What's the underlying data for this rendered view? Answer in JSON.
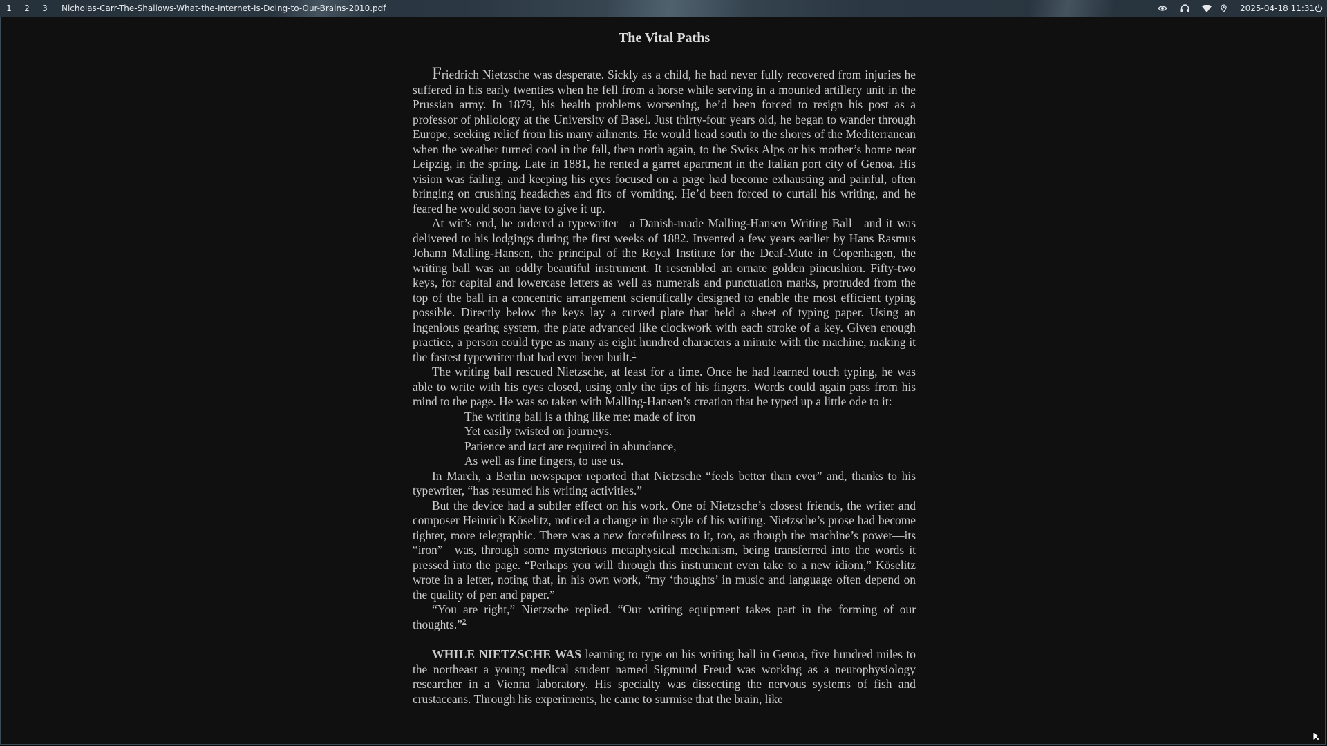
{
  "topbar": {
    "workspaces": [
      "1",
      "2",
      "3"
    ],
    "window_title": "Nicholas-Carr-The-Shallows-What-the-Internet-Is-Doing-to-Our-Brains-2010.pdf",
    "clock": "2025-04-18 11:31",
    "tray_icons": [
      "eye-icon",
      "headphones-icon",
      "wifi-icon",
      "location-icon",
      "power-icon"
    ]
  },
  "document": {
    "chapter_title": "The Vital Paths",
    "p1_dropcap": "F",
    "p1_rest": "riedrich Nietzsche was desperate. Sickly as a child, he had never fully recovered from injuries he suffered in his early twenties when he fell from a horse while serving in a mounted artillery unit in the Prussian army. In 1879, his health problems worsening, he’d been forced to resign his post as a professor of philology at the University of Basel. Just thirty-four years old, he began to wander through Europe, seeking relief from his many ailments. He would head south to the shores of the Mediterranean when the weather turned cool in the fall, then north again, to the Swiss Alps or his mother’s home near Leipzig, in the spring. Late in 1881, he rented a garret apartment in the Italian port city of Genoa. His vision was failing, and keeping his eyes focused on a page had become exhausting and painful, often bringing on crushing headaches and fits of vomiting. He’d been forced to curtail his writing, and he feared he would soon have to give it up.",
    "p2": "At wit’s end, he ordered a typewriter—a Danish-made Malling-Hansen Writing Ball—and it was delivered to his lodgings during the first weeks of 1882. Invented a few years earlier by Hans Rasmus Johann Malling-Hansen, the principal of the Royal Institute for the Deaf-Mute in Copenhagen, the writing ball was an oddly beautiful instrument. It resembled an ornate golden pincushion. Fifty-two keys, for capital and lowercase letters as well as numerals and punctuation marks, protruded from the top of the ball in a concentric arrangement scientifically designed to enable the most efficient typing possible. Directly below the keys lay a curved plate that held a sheet of typing paper. Using an ingenious gearing system, the plate advanced like clockwork with each stroke of a key. Given enough practice, a person could type as many as eight hundred characters a minute with the machine, making it the fastest typewriter that had ever been built.",
    "p2_note": "1",
    "p3": "The writing ball rescued Nietzsche, at least for a time. Once he had learned touch typing, he was able to write with his eyes closed, using only the tips of his fingers. Words could again pass from his mind to the page. He was so taken with Malling-Hansen’s creation that he typed up a little ode to it:",
    "verse": [
      "The writing ball is a thing like me: made of iron",
      "Yet easily twisted on journeys.",
      "Patience and tact are required in abundance,",
      "As well as fine fingers, to use us."
    ],
    "p4": "In March, a Berlin newspaper reported that Nietzsche “feels better than ever” and, thanks to his typewriter, “has resumed his writing activities.”",
    "p5": "But the device had a subtler effect on his work. One of Nietzsche’s closest friends, the writer and composer Heinrich Köselitz, noticed a change in the style of his writing. Nietzsche’s prose had become tighter, more telegraphic. There was a new forcefulness to it, too, as though the machine’s power—its “iron”—was, through some mysterious metaphysical mechanism, being transferred into the words it pressed into the page. “Perhaps you will through this instrument even take to a new idiom,” Köselitz wrote in a letter, noting that, in his own work, “my ‘thoughts’ in music and language often depend on the quality of pen and paper.”",
    "p6": "“You are right,” Nietzsche replied. “Our writing equipment takes part in the forming of our thoughts.”",
    "p6_note": "2",
    "p7_lead": "WHILE NIETZSCHE WAS",
    "p7_rest": " learning to type on his writing ball in Genoa, five hundred miles to the northeast a young medical student named Sigmund Freud was working as a neurophysiology researcher in a Vienna laboratory. His specialty was dissecting the nervous systems of fish and crustaceans. Through his experiments, he came to surmise that the brain, like"
  }
}
